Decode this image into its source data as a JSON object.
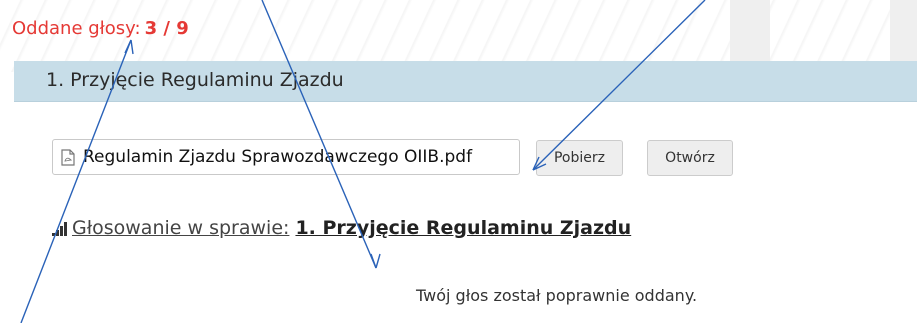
{
  "votes": {
    "label": "Oddane głosy:",
    "count": "3 / 9"
  },
  "section": {
    "title": "1. Przyjęcie Regulaminu Zjazdu"
  },
  "file": {
    "name": "Regulamin Zjazdu Sprawozdawczego OIIB.pdf",
    "icon": "pdf-file-icon"
  },
  "buttons": {
    "download": "Pobierz",
    "open": "Otwórz"
  },
  "vote_link": {
    "prefix": "Głosowanie w sprawie:",
    "subject": "1. Przyjęcie Regulaminu Zjazdu",
    "icon": "signal-bars-icon"
  },
  "confirmation": "Twój głos został poprawnie oddany.",
  "colors": {
    "accent_red": "#e53935",
    "header_blue": "#c7dde8",
    "annotation_arrow": "#2a62b8"
  }
}
